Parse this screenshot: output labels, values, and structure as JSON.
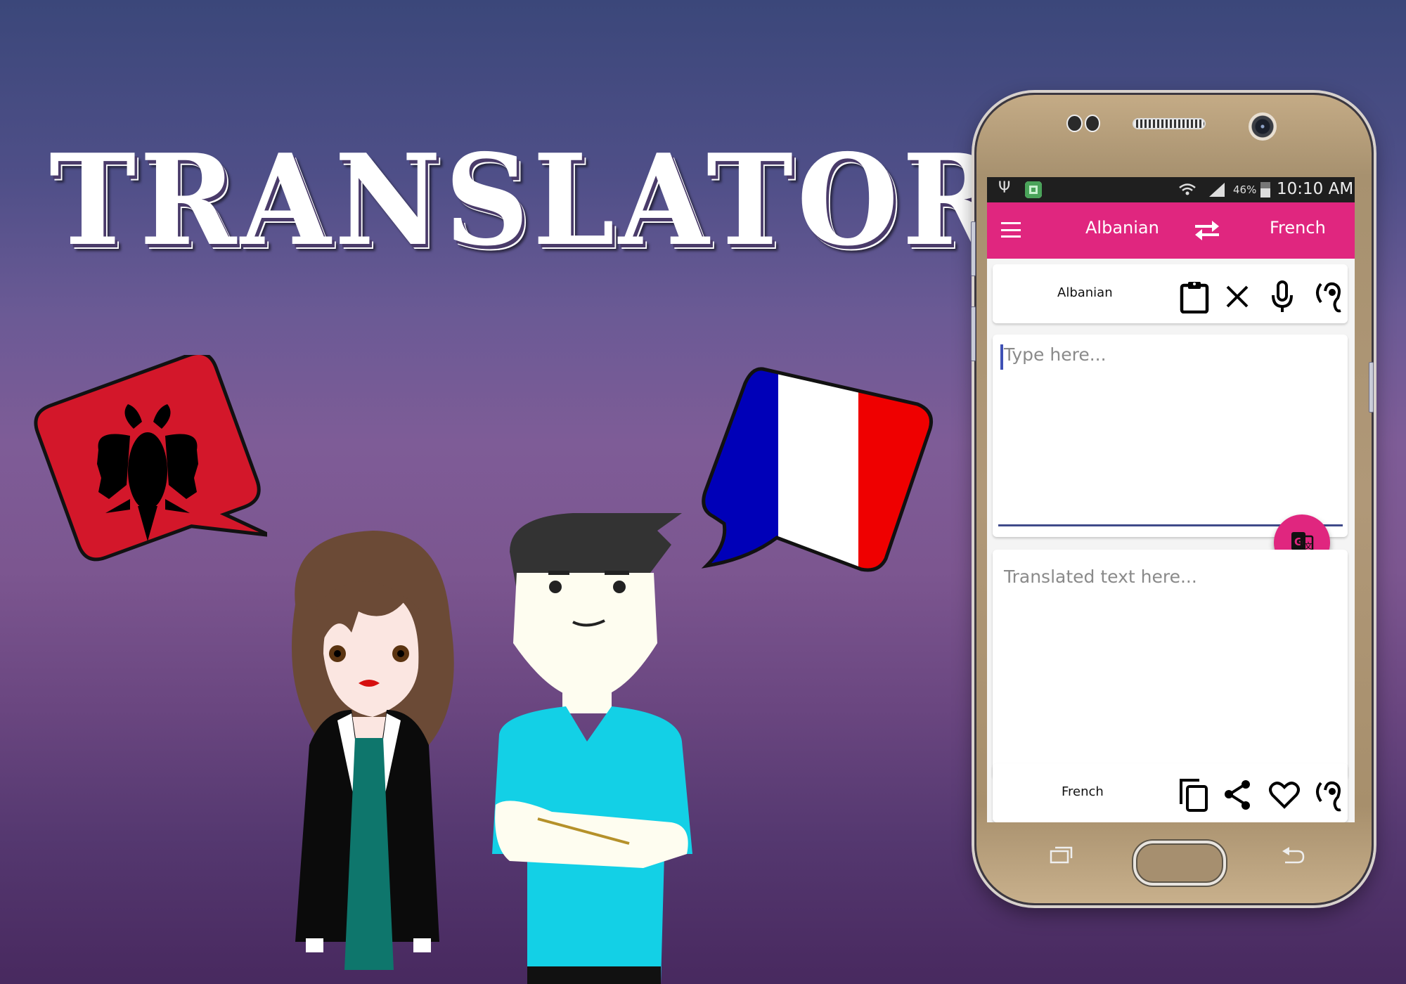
{
  "banner": {
    "title": "TRANSLATOR",
    "background_top": "#3b477a",
    "background_bottom": "#48295f"
  },
  "flags": [
    {
      "name": "Albania",
      "colors": [
        "#d3172a",
        "#000000"
      ]
    },
    {
      "name": "France",
      "colors": [
        "#0000b8",
        "#ffffff",
        "#ef0000"
      ]
    }
  ],
  "phone": {
    "status_bar": {
      "icons_left": [
        "usb-icon",
        "app-notification-icon"
      ],
      "icons_right": [
        "wifi-icon",
        "signal-icon"
      ],
      "battery": "46%",
      "time": "10:10 AM"
    },
    "app_bar": {
      "menu_icon": "hamburger-menu-icon",
      "source_language": "Albanian",
      "swap_icon": "swap-arrows-icon",
      "target_language": "French",
      "color": "#e0267f"
    },
    "source_panel": {
      "language": "Albanian",
      "actions": [
        {
          "icon": "clipboard-paste-icon",
          "label": "Paste"
        },
        {
          "icon": "clear-icon",
          "label": "Clear"
        },
        {
          "icon": "microphone-icon",
          "label": "Voice input"
        },
        {
          "icon": "listen-ear-icon",
          "label": "Listen"
        }
      ]
    },
    "input": {
      "placeholder": "Type here...",
      "value": ""
    },
    "translate_button": {
      "icon": "google-translate-icon",
      "color": "#e0267f"
    },
    "output": {
      "placeholder": "Translated text here...",
      "value": ""
    },
    "target_panel": {
      "language": "French",
      "actions": [
        {
          "icon": "copy-icon",
          "label": "Copy"
        },
        {
          "icon": "share-icon",
          "label": "Share"
        },
        {
          "icon": "favorite-heart-icon",
          "label": "Favorite"
        },
        {
          "icon": "listen-ear-icon",
          "label": "Listen"
        }
      ]
    },
    "nav_keys": [
      "recent-apps-icon",
      "home-button",
      "back-icon"
    ]
  }
}
